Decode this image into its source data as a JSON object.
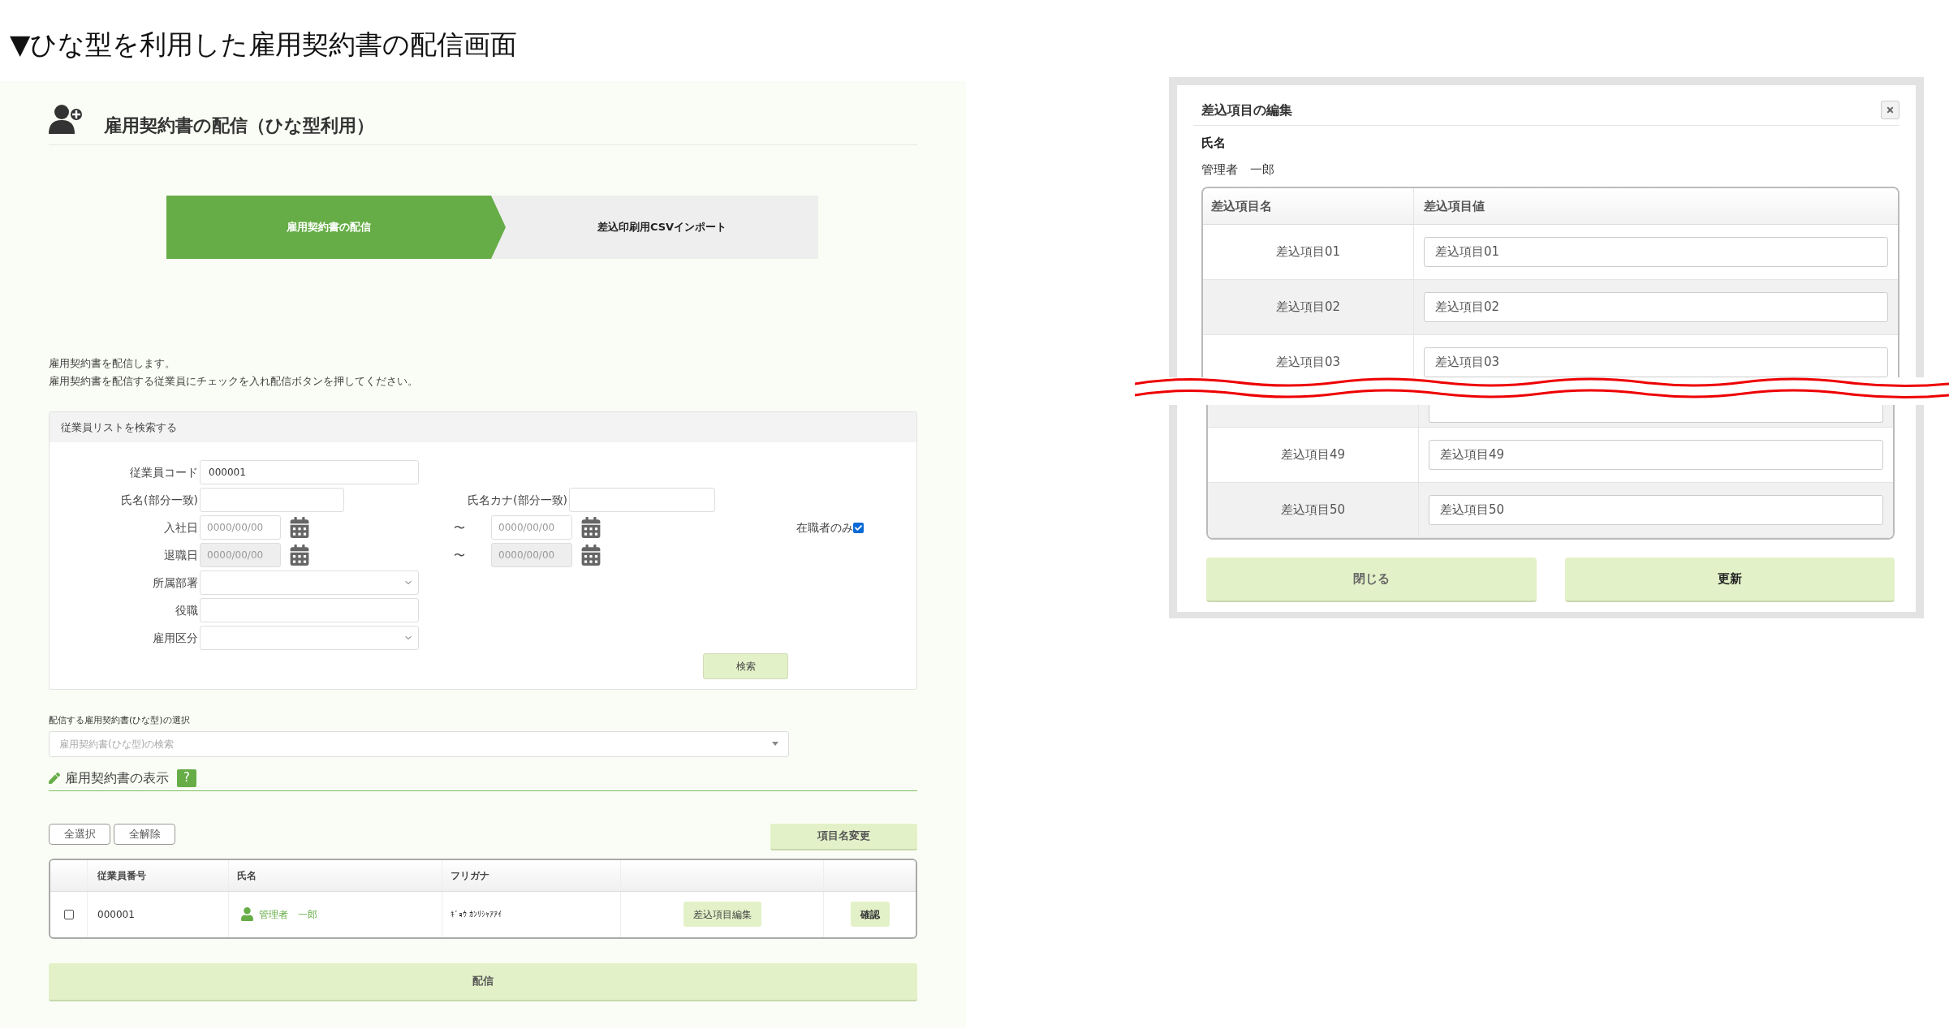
{
  "heading": "▼ひな型を利用した雇用契約書の配信画面",
  "distribution_screen": {
    "title": "雇用契約書の配信（ひな型利用）",
    "steps": [
      {
        "label": "雇用契約書の配信",
        "selected": true
      },
      {
        "label": "差込印刷用CSVインポート",
        "selected": false
      }
    ],
    "intro": [
      "雇用契約書を配信します。",
      "雇用契約書を配信する従業員にチェックを入れ配信ボタンを押してください。"
    ],
    "search_panel": {
      "title": "従業員リストを検索する",
      "employee_code": {
        "label": "従業員コード",
        "value": "000001"
      },
      "name": {
        "label": "氏名(部分一致)"
      },
      "name_kana": {
        "label": "氏名カナ(部分一致)"
      },
      "hire_date": {
        "label": "入社日",
        "from_placeholder": "0000/00/00",
        "separator": "〜",
        "to_placeholder": "0000/00/00",
        "disabled": false
      },
      "retire_date": {
        "label": "退職日",
        "from_placeholder": "0000/00/00",
        "separator": "〜",
        "to_placeholder": "0000/00/00",
        "disabled": true
      },
      "employed_only": {
        "label": "在職者のみ",
        "checked": true
      },
      "department": {
        "label": "所属部署"
      },
      "position": {
        "label": "役職"
      },
      "employment_type": {
        "label": "雇用区分"
      },
      "search_button": "検索"
    },
    "template_select": {
      "label": "配信する雇用契約書(ひな型)の選択",
      "placeholder": "雇用契約書(ひな型)の検索"
    },
    "display_section": {
      "title": "雇用契約書の表示",
      "help": "?"
    },
    "select_all_button": "全選択",
    "clear_all_button": "全解除",
    "rename_button": "項目名変更",
    "table": {
      "columns": [
        "従業員番号",
        "氏名",
        "フリガナ"
      ],
      "rows": [
        {
          "checked": false,
          "number": "000001",
          "name": "管理者　一郎",
          "furigana": "ｷﾞｮｳ ｶﾝﾘｼｬｱｱｲ",
          "edit_button": "差込項目編集",
          "confirm_button": "確認"
        }
      ]
    },
    "distribute_button": "配信"
  },
  "edit_dialog": {
    "title": "差込項目の編集",
    "name_label": "氏名",
    "name_value": "管理者　一郎",
    "columns": [
      "差込項目名",
      "差込項目値"
    ],
    "rows_top": [
      {
        "name": "差込項目01",
        "value": "差込項目01"
      },
      {
        "name": "差込項目02",
        "value": "差込項目02"
      },
      {
        "name": "差込項目03",
        "value": "差込項目03"
      }
    ],
    "rows_bottom": [
      {
        "name": "差込項目49",
        "value": "差込項目49"
      },
      {
        "name": "差込項目50",
        "value": "差込項目50"
      }
    ],
    "close_button": "閉じる",
    "update_button": "更新"
  }
}
